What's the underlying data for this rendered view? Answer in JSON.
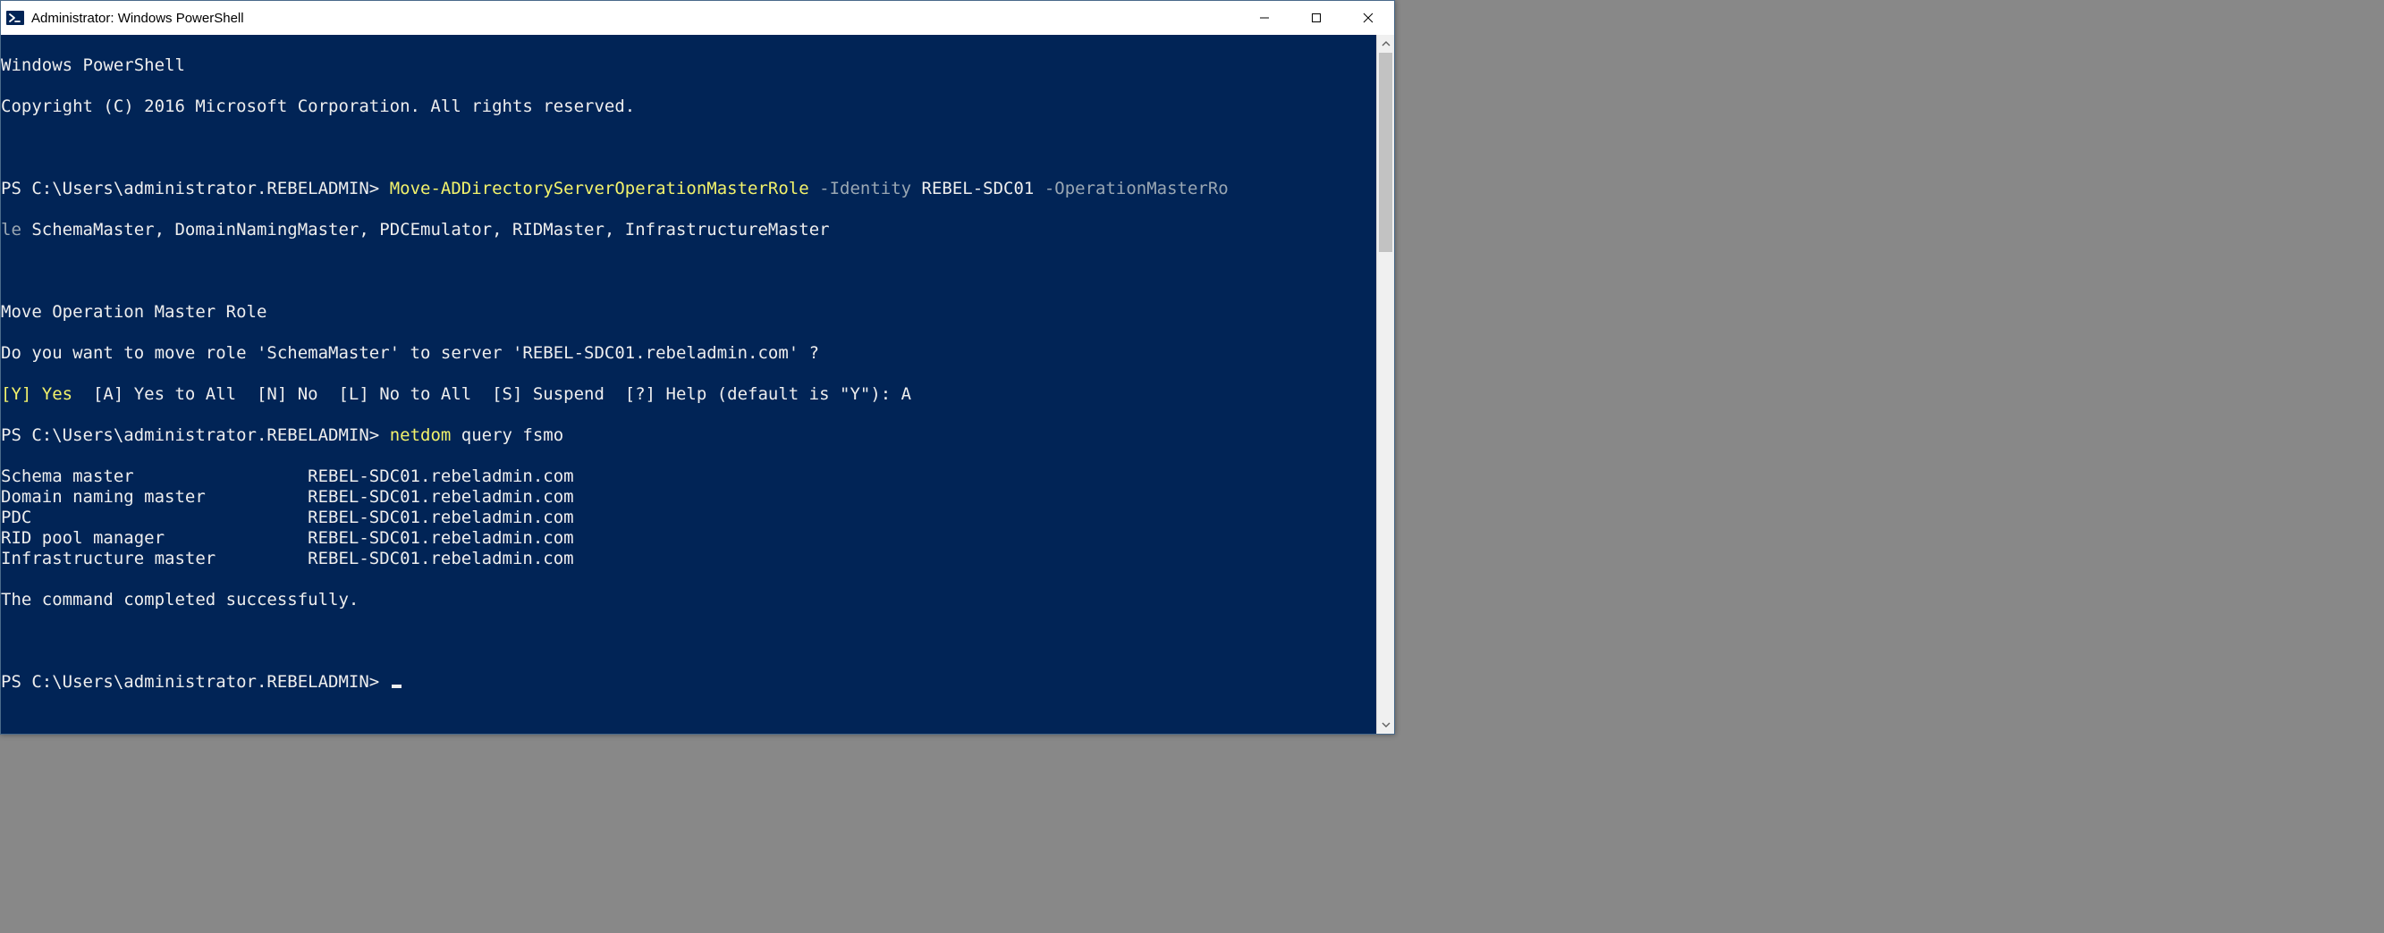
{
  "window": {
    "title": "Administrator: Windows PowerShell"
  },
  "terminal": {
    "header1": "Windows PowerShell",
    "header2": "Copyright (C) 2016 Microsoft Corporation. All rights reserved.",
    "prompt": "PS C:\\Users\\administrator.REBELADMIN> ",
    "cmd1_cmdlet": "Move-ADDirectoryServerOperationMasterRole",
    "cmd1_p1_name": " -Identity ",
    "cmd1_p1_val": "REBEL-SDC01",
    "cmd1_p2_name": " -OperationMasterRo",
    "cmd1_line2_pre": "le ",
    "cmd1_line2_val": "SchemaMaster, DomainNamingMaster, PDCEmulator, RIDMaster, InfrastructureMaster",
    "confirm_title": "Move Operation Master Role",
    "confirm_q": "Do you want to move role 'SchemaMaster' to server 'REBEL-SDC01.rebeladmin.com' ?",
    "confirm_yes": "[Y] Yes",
    "confirm_rest": "  [A] Yes to All  [N] No  [L] No to All  [S] Suspend  [?] Help (default is \"Y\"): A",
    "cmd2_cmdlet": "netdom",
    "cmd2_args": " query fsmo",
    "fsmo": [
      {
        "role": "Schema master",
        "pad": "                 ",
        "host": "REBEL-SDC01.rebeladmin.com"
      },
      {
        "role": "Domain naming master",
        "pad": "          ",
        "host": "REBEL-SDC01.rebeladmin.com"
      },
      {
        "role": "PDC",
        "pad": "                           ",
        "host": "REBEL-SDC01.rebeladmin.com"
      },
      {
        "role": "RID pool manager",
        "pad": "              ",
        "host": "REBEL-SDC01.rebeladmin.com"
      },
      {
        "role": "Infrastructure master",
        "pad": "         ",
        "host": "REBEL-SDC01.rebeladmin.com"
      }
    ],
    "done": "The command completed successfully."
  },
  "scrollbar": {
    "thumb_top_pct": 0,
    "thumb_height_pct": 30
  }
}
